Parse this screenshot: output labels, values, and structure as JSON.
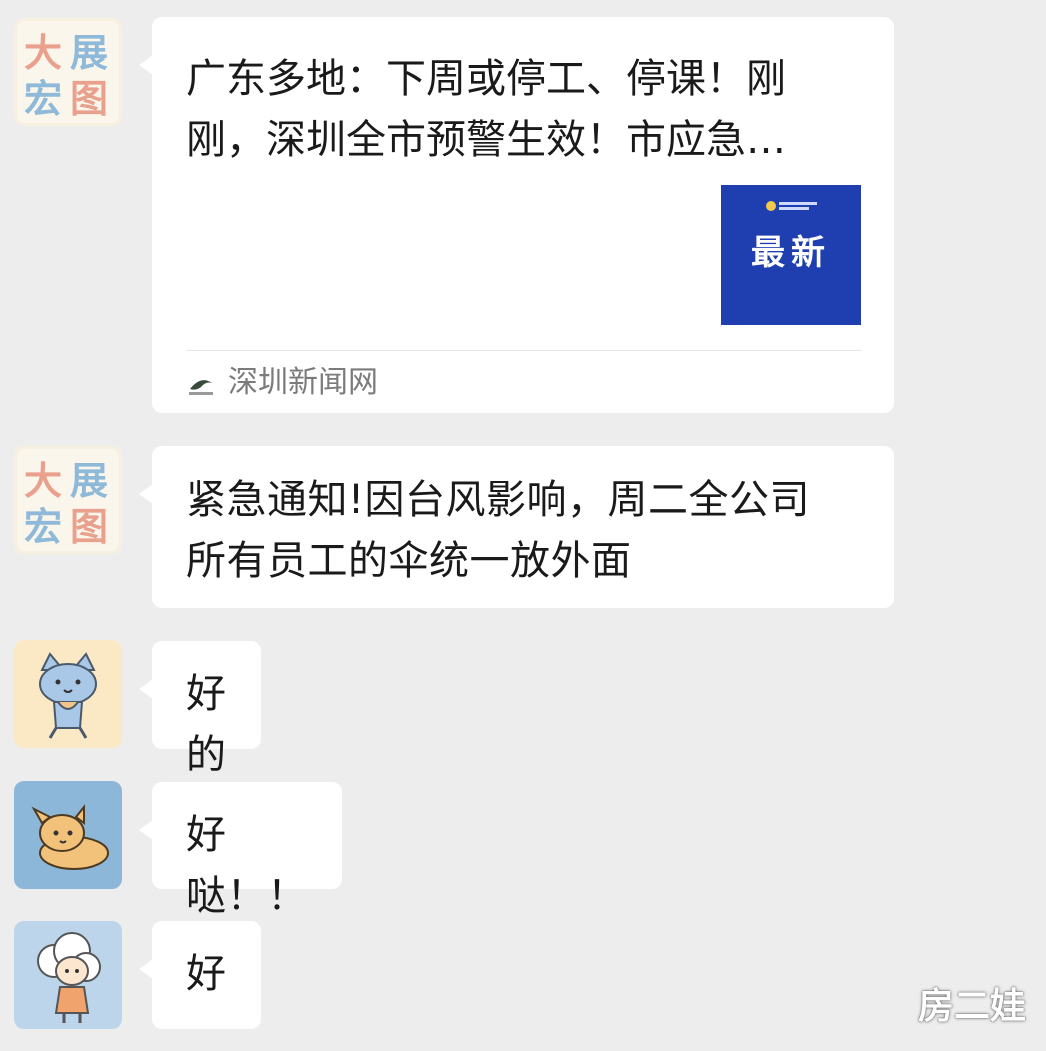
{
  "messages": [
    {
      "type": "link-card",
      "avatar": {
        "kind": "group-logo",
        "chars": [
          "大",
          "展",
          "宏",
          "图"
        ]
      },
      "title_line1": "广东多地：下周或停工、停课！刚",
      "title_line2": "刚，深圳全市预警生效！市应急…",
      "thumbnail_text": "最新",
      "source_name": "深圳新闻网"
    },
    {
      "type": "text",
      "avatar": {
        "kind": "group-logo",
        "chars": [
          "大",
          "展",
          "宏",
          "图"
        ]
      },
      "line1": "紧急通知!因台风影响，周二全公司",
      "line2": "所有员工的伞统一放外面"
    },
    {
      "type": "text",
      "avatar": {
        "kind": "cartoon-cat"
      },
      "text": "好的"
    },
    {
      "type": "text",
      "avatar": {
        "kind": "cartoon-dog"
      },
      "text": "好哒！！"
    },
    {
      "type": "text",
      "avatar": {
        "kind": "cartoon-girl"
      },
      "text": "好"
    }
  ],
  "watermark": "房二娃",
  "colors": {
    "background": "#ededed",
    "bubble": "#ffffff",
    "thumbnail": "#1f3fb0",
    "source_text": "#7b7b7b"
  }
}
